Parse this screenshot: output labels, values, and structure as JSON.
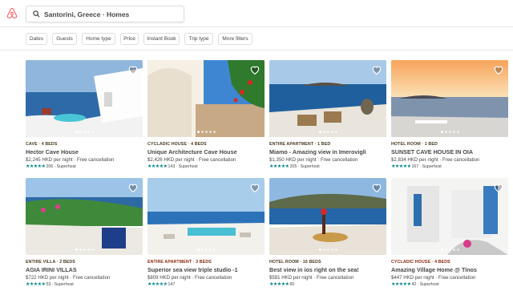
{
  "search": {
    "query": "Santorini, Greece · Homes"
  },
  "filters": [
    "Dates",
    "Guests",
    "Home type",
    "Price",
    "Instant Book",
    "Trip type",
    "More filters"
  ],
  "colors": {
    "brand": "#FF5A5F",
    "rating": "#008489",
    "type_teal": "#6B4A1E",
    "type_red": "#7A2A12"
  },
  "listings": [
    {
      "type": "CAVE · 4 BEDS",
      "title": "Hector Cave House",
      "price": "$2,245 HKD per night · Free cancellation",
      "stars": "★★★★★",
      "reviews": "206",
      "superhost": "· Superhost",
      "type_color": "#4b3a1f"
    },
    {
      "type": "CYCLADIC HOUSE · 4 BEDS",
      "title": "Unique Architecture Cave House",
      "price": "$2,426 HKD per night · Free cancellation",
      "stars": "★★★★★",
      "reviews": "143",
      "superhost": "· Superhost",
      "type_color": "#4b3a1f"
    },
    {
      "type": "ENTIRE APARTMENT · 1 BED",
      "title": "Miamo - Amazing view in Imerovigli",
      "price": "$1,350 HKD per night · Free cancellation",
      "stars": "★★★★★",
      "reviews": "205",
      "superhost": "· Superhost",
      "type_color": "#4b3a1f"
    },
    {
      "type": "HOTEL ROOM · 1 BED",
      "title": "SUNSET CAVE HOUSE IN OIA",
      "price": "$2,834 HKD per night · Free cancellation",
      "stars": "★★★★★",
      "reviews": "167",
      "superhost": "· Superhost",
      "type_color": "#4b3a1f"
    },
    {
      "type": "ENTIRE VILLA · 2 BEDS",
      "title": "AGIA IRINI VILLAS",
      "price": "$722 HKD per night · Free cancellation",
      "stars": "★★★★★",
      "reviews": "53",
      "superhost": "· Superhost",
      "type_color": "#4b3a1f"
    },
    {
      "type": "ENTIRE APARTMENT · 3 BEDS",
      "title": "Superior sea view triple studio -1",
      "price": "$809 HKD per night · Free cancellation",
      "stars": "★★★★★",
      "reviews": "147",
      "superhost": "",
      "type_color": "#8a2a10"
    },
    {
      "type": "HOTEL ROOM · 16 BEDS",
      "title": "Best view in ios right on the sea!",
      "price": "$581 HKD per night · Free cancellation",
      "stars": "★★★★★",
      "reviews": "60",
      "superhost": "",
      "type_color": "#4b3a1f"
    },
    {
      "type": "CYCLADIC HOUSE · 4 BEDS",
      "title": "Amazing Village Home @ Tinos",
      "price": "$447 HKD per night · Free cancellation",
      "stars": "★★★★★",
      "reviews": "42",
      "superhost": "· Superhost",
      "type_color": "#8a2a10"
    }
  ]
}
